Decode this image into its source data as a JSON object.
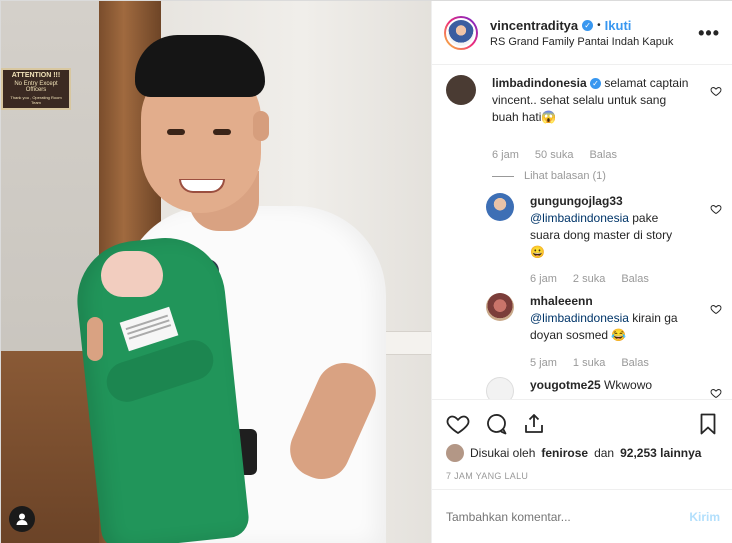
{
  "photo": {
    "sign": {
      "title": "ATTENTION !!!",
      "line2": "No Entry Except Officers",
      "line3": "Thank you , Operating Room Team"
    }
  },
  "post": {
    "author": "vincentraditya",
    "follow_label": "Ikuti",
    "separator": "•",
    "location": "RS Grand Family Pantai Indah Kapuk",
    "more_label": "•••"
  },
  "comments": [
    {
      "user": "limbadindonesia",
      "text": "selamat captain vincent.. sehat selalu untuk sang buah hati",
      "emoji": "😱",
      "age": "6 jam",
      "likes": "50 suka",
      "reply_label": "Balas",
      "view_replies": "Lihat balasan (1)"
    },
    {
      "user": "gungungojlag33",
      "mention": "@limbadindonesia",
      "text": "pake suara dong master di story",
      "emoji": "😀",
      "age": "6 jam",
      "likes": "2 suka",
      "reply_label": "Balas"
    },
    {
      "user": "mhaleeenn",
      "mention": "@limbadindonesia",
      "text": "kirain ga doyan sosmed",
      "emoji": "😂",
      "age": "5 jam",
      "likes": "1 suka",
      "reply_label": "Balas"
    },
    {
      "user": "yougotme25",
      "text": "Wkwowo"
    }
  ],
  "engagement": {
    "liked_by_prefix": "Disukai oleh",
    "liked_by_user": "fenirose",
    "liked_by_connector": "dan",
    "liked_by_count": "92,253 lainnya",
    "timestamp": "7 JAM YANG LALU"
  },
  "add_comment": {
    "placeholder": "Tambahkan komentar...",
    "post_label": "Kirim"
  },
  "colors": {
    "link": "#3897f0",
    "muted": "#999999",
    "text": "#262626"
  }
}
